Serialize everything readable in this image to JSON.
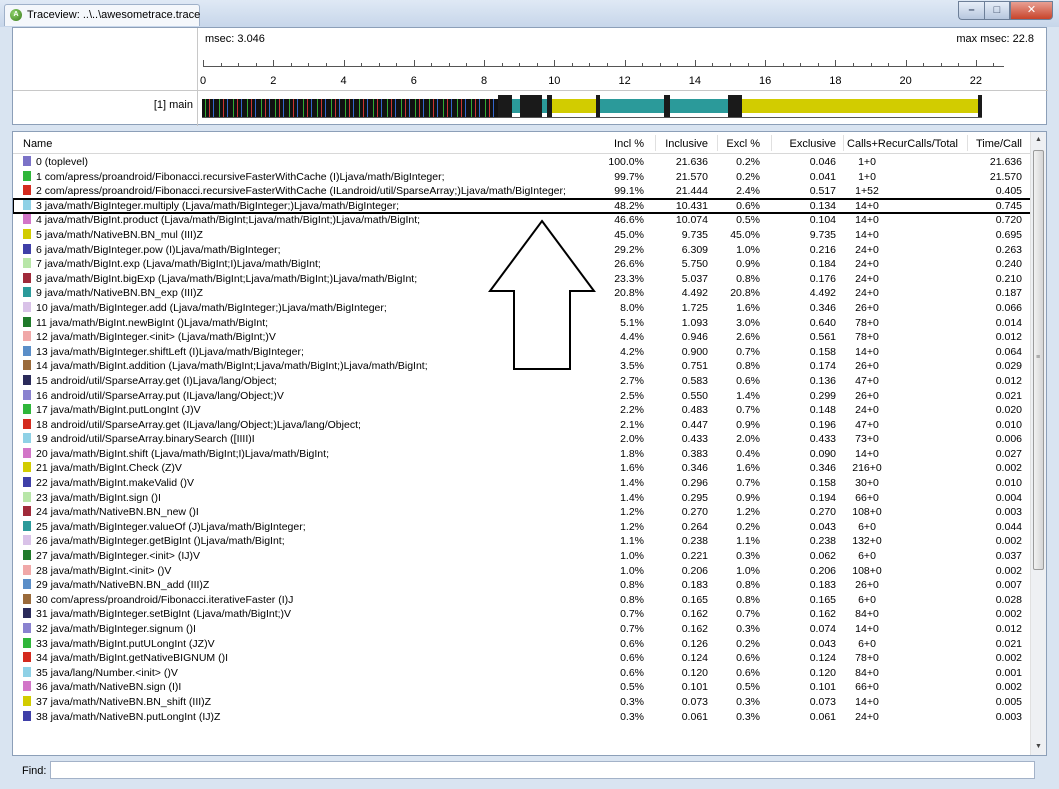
{
  "window": {
    "title": "Traceview: ..\\..\\awesometrace.trace",
    "min_symbol": "–",
    "max_symbol": "□",
    "close_symbol": "✕"
  },
  "timeline": {
    "msec_label": "msec: 3.046",
    "max_msec_label": "max msec: 22.8",
    "ticks": [
      "0",
      "2",
      "4",
      "6",
      "8",
      "10",
      "12",
      "14",
      "16",
      "18",
      "20",
      "22"
    ],
    "thread_label": "[1] main",
    "thread_colors": {
      "dense": "#1a1a1a",
      "yellow": "#d2cc00",
      "teal": "#2b9a9a"
    }
  },
  "table": {
    "headers": {
      "name": "Name",
      "incl_pct": "Incl %",
      "inclusive": "Inclusive",
      "excl_pct": "Excl %",
      "exclusive": "Exclusive",
      "calls": "Calls+RecurCalls/Total",
      "time_per_call": "Time/Call"
    },
    "highlighted_row": 3,
    "rows": [
      {
        "color": "#7b72c7",
        "name": "0 (toplevel)",
        "incl": "100.0%",
        "inclusive": "21.636",
        "excl": "0.2%",
        "exclusive": "0.046",
        "calls": "1+0",
        "time": "21.636"
      },
      {
        "color": "#2fb63a",
        "name": "1 com/apress/proandroid/Fibonacci.recursiveFasterWithCache (I)Ljava/math/BigInteger;",
        "incl": "99.7%",
        "inclusive": "21.570",
        "excl": "0.2%",
        "exclusive": "0.041",
        "calls": "1+0",
        "time": "21.570"
      },
      {
        "color": "#d42a1e",
        "name": "2 com/apress/proandroid/Fibonacci.recursiveFasterWithCache (ILandroid/util/SparseArray;)Ljava/math/BigInteger;",
        "incl": "99.1%",
        "inclusive": "21.444",
        "excl": "2.4%",
        "exclusive": "0.517",
        "calls": "1+52",
        "time": "0.405"
      },
      {
        "color": "#8fd1e6",
        "name": "3 java/math/BigInteger.multiply (Ljava/math/BigInteger;)Ljava/math/BigInteger;",
        "incl": "48.2%",
        "inclusive": "10.431",
        "excl": "0.6%",
        "exclusive": "0.134",
        "calls": "14+0",
        "time": "0.745"
      },
      {
        "color": "#d275c8",
        "name": "4 java/math/BigInt.product (Ljava/math/BigInt;Ljava/math/BigInt;)Ljava/math/BigInt;",
        "incl": "46.6%",
        "inclusive": "10.074",
        "excl": "0.5%",
        "exclusive": "0.104",
        "calls": "14+0",
        "time": "0.720"
      },
      {
        "color": "#d2cc00",
        "name": "5 java/math/NativeBN.BN_mul (III)Z",
        "incl": "45.0%",
        "inclusive": "9.735",
        "excl": "45.0%",
        "exclusive": "9.735",
        "calls": "14+0",
        "time": "0.695"
      },
      {
        "color": "#3f3fa8",
        "name": "6 java/math/BigInteger.pow (I)Ljava/math/BigInteger;",
        "incl": "29.2%",
        "inclusive": "6.309",
        "excl": "1.0%",
        "exclusive": "0.216",
        "calls": "24+0",
        "time": "0.263"
      },
      {
        "color": "#b8e6a8",
        "name": "7 java/math/BigInt.exp (Ljava/math/BigInt;I)Ljava/math/BigInt;",
        "incl": "26.6%",
        "inclusive": "5.750",
        "excl": "0.9%",
        "exclusive": "0.184",
        "calls": "24+0",
        "time": "0.240"
      },
      {
        "color": "#a02a3a",
        "name": "8 java/math/BigInt.bigExp (Ljava/math/BigInt;Ljava/math/BigInt;)Ljava/math/BigInt;",
        "incl": "23.3%",
        "inclusive": "5.037",
        "excl": "0.8%",
        "exclusive": "0.176",
        "calls": "24+0",
        "time": "0.210"
      },
      {
        "color": "#2b9a9a",
        "name": "9 java/math/NativeBN.BN_exp (III)Z",
        "incl": "20.8%",
        "inclusive": "4.492",
        "excl": "20.8%",
        "exclusive": "4.492",
        "calls": "24+0",
        "time": "0.187"
      },
      {
        "color": "#d9c2e8",
        "name": "10 java/math/BigInteger.add (Ljava/math/BigInteger;)Ljava/math/BigInteger;",
        "incl": "8.0%",
        "inclusive": "1.725",
        "excl": "1.6%",
        "exclusive": "0.346",
        "calls": "26+0",
        "time": "0.066"
      },
      {
        "color": "#1f7a2a",
        "name": "11 java/math/BigInt.newBigInt ()Ljava/math/BigInt;",
        "incl": "5.1%",
        "inclusive": "1.093",
        "excl": "3.0%",
        "exclusive": "0.640",
        "calls": "78+0",
        "time": "0.014"
      },
      {
        "color": "#f0a8a8",
        "name": "12 java/math/BigInteger.<init> (Ljava/math/BigInt;)V",
        "incl": "4.4%",
        "inclusive": "0.946",
        "excl": "2.6%",
        "exclusive": "0.561",
        "calls": "78+0",
        "time": "0.012"
      },
      {
        "color": "#5a8ec8",
        "name": "13 java/math/BigInteger.shiftLeft (I)Ljava/math/BigInteger;",
        "incl": "4.2%",
        "inclusive": "0.900",
        "excl": "0.7%",
        "exclusive": "0.158",
        "calls": "14+0",
        "time": "0.064"
      },
      {
        "color": "#9a6a3a",
        "name": "14 java/math/BigInt.addition (Ljava/math/BigInt;Ljava/math/BigInt;)Ljava/math/BigInt;",
        "incl": "3.5%",
        "inclusive": "0.751",
        "excl": "0.8%",
        "exclusive": "0.174",
        "calls": "26+0",
        "time": "0.029"
      },
      {
        "color": "#2a2a5a",
        "name": "15 android/util/SparseArray.get (I)Ljava/lang/Object;",
        "incl": "2.7%",
        "inclusive": "0.583",
        "excl": "0.6%",
        "exclusive": "0.136",
        "calls": "47+0",
        "time": "0.012"
      },
      {
        "color": "#8a82d0",
        "name": "16 android/util/SparseArray.put (ILjava/lang/Object;)V",
        "incl": "2.5%",
        "inclusive": "0.550",
        "excl": "1.4%",
        "exclusive": "0.299",
        "calls": "26+0",
        "time": "0.021"
      },
      {
        "color": "#2fb63a",
        "name": "17 java/math/BigInt.putLongInt (J)V",
        "incl": "2.2%",
        "inclusive": "0.483",
        "excl": "0.7%",
        "exclusive": "0.148",
        "calls": "24+0",
        "time": "0.020"
      },
      {
        "color": "#d42a1e",
        "name": "18 android/util/SparseArray.get (ILjava/lang/Object;)Ljava/lang/Object;",
        "incl": "2.1%",
        "inclusive": "0.447",
        "excl": "0.9%",
        "exclusive": "0.196",
        "calls": "47+0",
        "time": "0.010"
      },
      {
        "color": "#8fd1e6",
        "name": "19 android/util/SparseArray.binarySearch ([IIII)I",
        "incl": "2.0%",
        "inclusive": "0.433",
        "excl": "2.0%",
        "exclusive": "0.433",
        "calls": "73+0",
        "time": "0.006"
      },
      {
        "color": "#d275c8",
        "name": "20 java/math/BigInt.shift (Ljava/math/BigInt;I)Ljava/math/BigInt;",
        "incl": "1.8%",
        "inclusive": "0.383",
        "excl": "0.4%",
        "exclusive": "0.090",
        "calls": "14+0",
        "time": "0.027"
      },
      {
        "color": "#d2cc00",
        "name": "21 java/math/BigInt.Check (Z)V",
        "incl": "1.6%",
        "inclusive": "0.346",
        "excl": "1.6%",
        "exclusive": "0.346",
        "calls": "216+0",
        "time": "0.002"
      },
      {
        "color": "#3f3fa8",
        "name": "22 java/math/BigInt.makeValid ()V",
        "incl": "1.4%",
        "inclusive": "0.296",
        "excl": "0.7%",
        "exclusive": "0.158",
        "calls": "30+0",
        "time": "0.010"
      },
      {
        "color": "#b8e6a8",
        "name": "23 java/math/BigInt.sign ()I",
        "incl": "1.4%",
        "inclusive": "0.295",
        "excl": "0.9%",
        "exclusive": "0.194",
        "calls": "66+0",
        "time": "0.004"
      },
      {
        "color": "#a02a3a",
        "name": "24 java/math/NativeBN.BN_new ()I",
        "incl": "1.2%",
        "inclusive": "0.270",
        "excl": "1.2%",
        "exclusive": "0.270",
        "calls": "108+0",
        "time": "0.003"
      },
      {
        "color": "#2b9a9a",
        "name": "25 java/math/BigInteger.valueOf (J)Ljava/math/BigInteger;",
        "incl": "1.2%",
        "inclusive": "0.264",
        "excl": "0.2%",
        "exclusive": "0.043",
        "calls": "6+0",
        "time": "0.044"
      },
      {
        "color": "#d9c2e8",
        "name": "26 java/math/BigInteger.getBigInt ()Ljava/math/BigInt;",
        "incl": "1.1%",
        "inclusive": "0.238",
        "excl": "1.1%",
        "exclusive": "0.238",
        "calls": "132+0",
        "time": "0.002"
      },
      {
        "color": "#1f7a2a",
        "name": "27 java/math/BigInteger.<init> (IJ)V",
        "incl": "1.0%",
        "inclusive": "0.221",
        "excl": "0.3%",
        "exclusive": "0.062",
        "calls": "6+0",
        "time": "0.037"
      },
      {
        "color": "#f0a8a8",
        "name": "28 java/math/BigInt.<init> ()V",
        "incl": "1.0%",
        "inclusive": "0.206",
        "excl": "1.0%",
        "exclusive": "0.206",
        "calls": "108+0",
        "time": "0.002"
      },
      {
        "color": "#5a8ec8",
        "name": "29 java/math/NativeBN.BN_add (III)Z",
        "incl": "0.8%",
        "inclusive": "0.183",
        "excl": "0.8%",
        "exclusive": "0.183",
        "calls": "26+0",
        "time": "0.007"
      },
      {
        "color": "#9a6a3a",
        "name": "30 com/apress/proandroid/Fibonacci.iterativeFaster (I)J",
        "incl": "0.8%",
        "inclusive": "0.165",
        "excl": "0.8%",
        "exclusive": "0.165",
        "calls": "6+0",
        "time": "0.028"
      },
      {
        "color": "#2a2a5a",
        "name": "31 java/math/BigInteger.setBigInt (Ljava/math/BigInt;)V",
        "incl": "0.7%",
        "inclusive": "0.162",
        "excl": "0.7%",
        "exclusive": "0.162",
        "calls": "84+0",
        "time": "0.002"
      },
      {
        "color": "#8a82d0",
        "name": "32 java/math/BigInteger.signum ()I",
        "incl": "0.7%",
        "inclusive": "0.162",
        "excl": "0.3%",
        "exclusive": "0.074",
        "calls": "14+0",
        "time": "0.012"
      },
      {
        "color": "#2fb63a",
        "name": "33 java/math/BigInt.putULongInt (JZ)V",
        "incl": "0.6%",
        "inclusive": "0.126",
        "excl": "0.2%",
        "exclusive": "0.043",
        "calls": "6+0",
        "time": "0.021"
      },
      {
        "color": "#d42a1e",
        "name": "34 java/math/BigInt.getNativeBIGNUM ()I",
        "incl": "0.6%",
        "inclusive": "0.124",
        "excl": "0.6%",
        "exclusive": "0.124",
        "calls": "78+0",
        "time": "0.002"
      },
      {
        "color": "#8fd1e6",
        "name": "35 java/lang/Number.<init> ()V",
        "incl": "0.6%",
        "inclusive": "0.120",
        "excl": "0.6%",
        "exclusive": "0.120",
        "calls": "84+0",
        "time": "0.001"
      },
      {
        "color": "#d275c8",
        "name": "36 java/math/NativeBN.sign (I)I",
        "incl": "0.5%",
        "inclusive": "0.101",
        "excl": "0.5%",
        "exclusive": "0.101",
        "calls": "66+0",
        "time": "0.002"
      },
      {
        "color": "#d2cc00",
        "name": "37 java/math/NativeBN.BN_shift (III)Z",
        "incl": "0.3%",
        "inclusive": "0.073",
        "excl": "0.3%",
        "exclusive": "0.073",
        "calls": "14+0",
        "time": "0.005"
      },
      {
        "color": "#3f3fa8",
        "name": "38 java/math/NativeBN.putLongInt (IJ)Z",
        "incl": "0.3%",
        "inclusive": "0.061",
        "excl": "0.3%",
        "exclusive": "0.061",
        "calls": "24+0",
        "time": "0.003"
      }
    ]
  },
  "find": {
    "label": "Find:",
    "value": "",
    "placeholder": ""
  }
}
